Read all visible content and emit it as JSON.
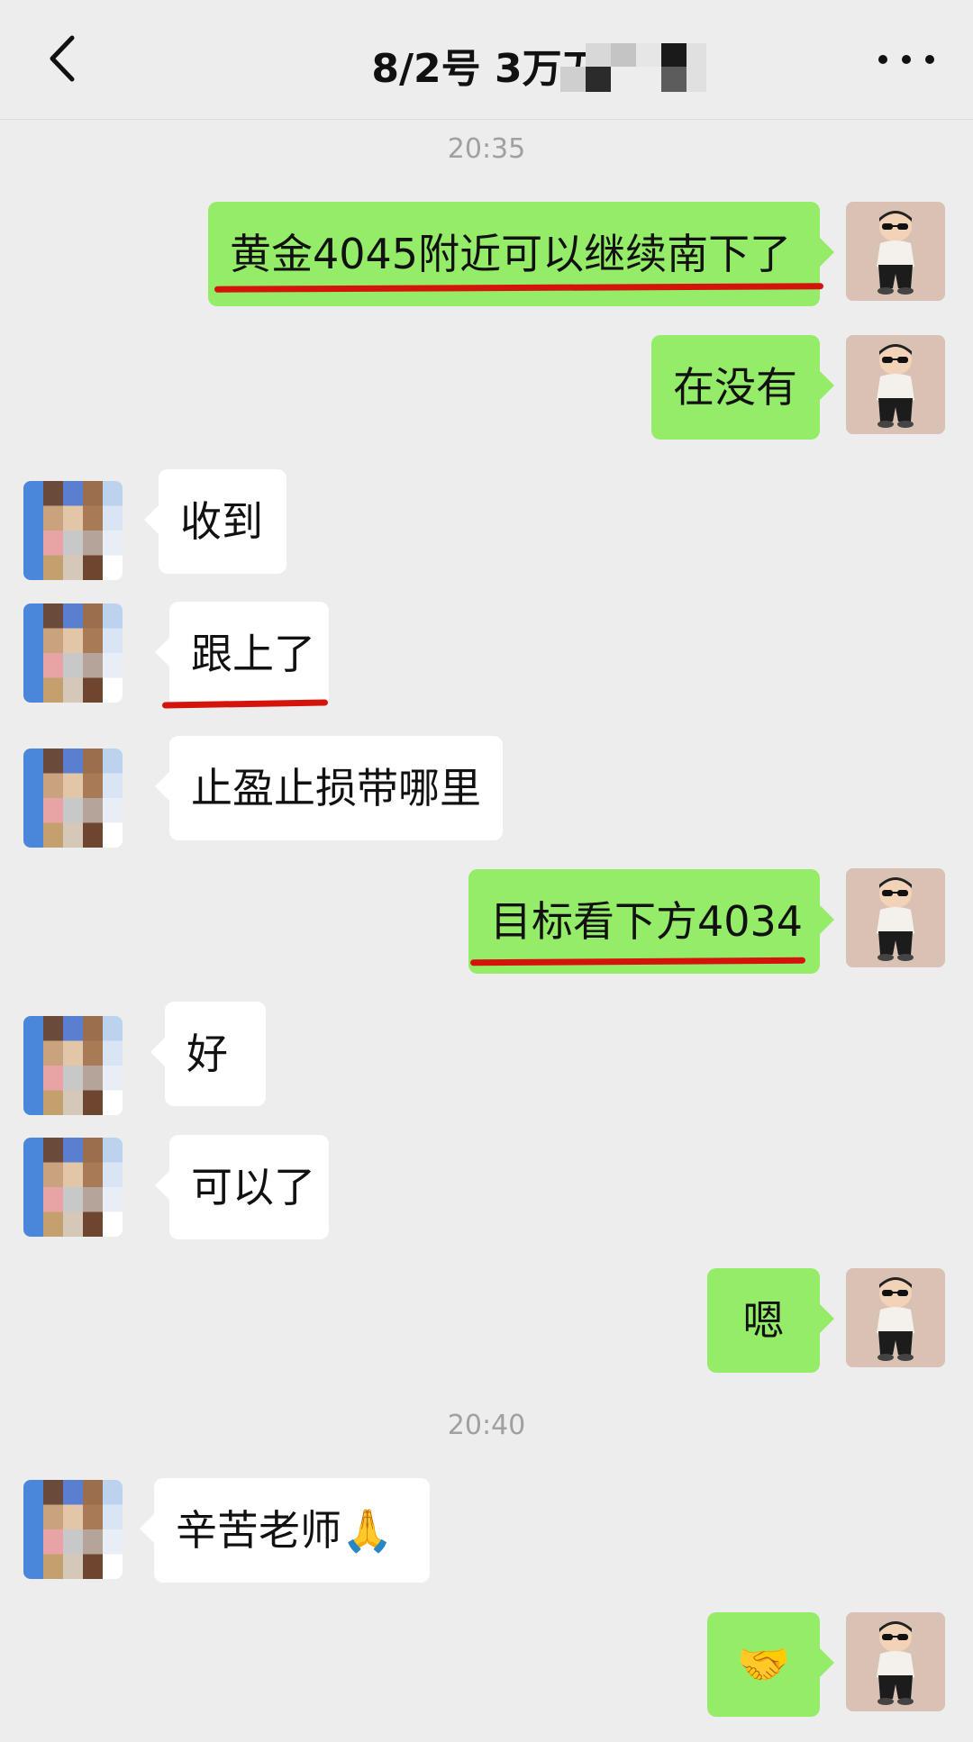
{
  "header": {
    "title": "8/2号  3万刀",
    "back_icon": "chevron-left-icon",
    "more_icon": "more-dots-icon"
  },
  "timestamps": [
    "20:35",
    "20:40"
  ],
  "messages": [
    {
      "side": "right",
      "text": "黄金4045附近可以继续南下了",
      "highlighted": true
    },
    {
      "side": "right",
      "text": "在没有"
    },
    {
      "side": "left",
      "text": "收到"
    },
    {
      "side": "left",
      "text": "跟上了",
      "highlighted": true
    },
    {
      "side": "left",
      "text": "止盈止损带哪里"
    },
    {
      "side": "right",
      "text": "目标看下方4034",
      "highlighted": true
    },
    {
      "side": "left",
      "text": "好"
    },
    {
      "side": "left",
      "text": "可以了"
    },
    {
      "side": "right",
      "text": "嗯"
    },
    {
      "side": "left",
      "text": "辛苦老师🙏"
    },
    {
      "side": "right",
      "text": "🤝"
    }
  ],
  "colors": {
    "self_bubble": "#95ec69",
    "other_bubble": "#ffffff",
    "highlight_line": "#d4140b",
    "background": "#ededed"
  }
}
